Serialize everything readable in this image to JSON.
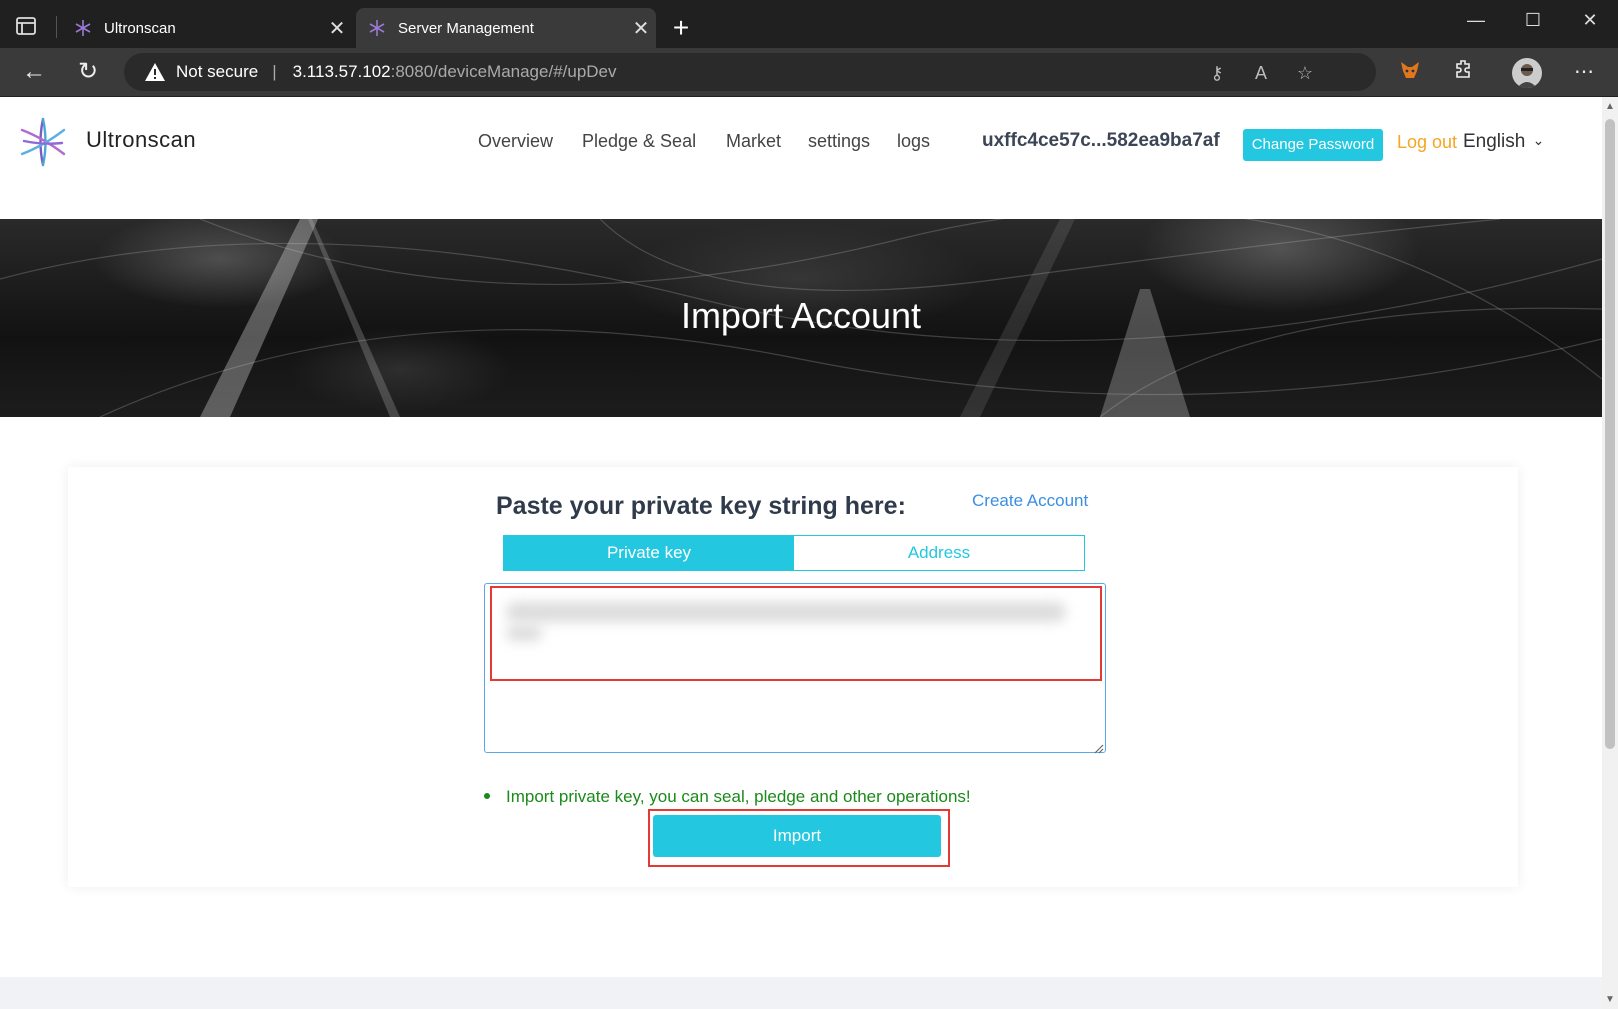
{
  "browser": {
    "tabs": [
      {
        "title": "Ultronscan",
        "active": false
      },
      {
        "title": "Server Management",
        "active": true
      }
    ],
    "address": {
      "security_label": "Not secure",
      "host": "3.113.57.102",
      "path": ":8080/deviceManage/#/upDev"
    }
  },
  "header": {
    "brand": "Ultronscan",
    "nav": [
      "Overview",
      "Pledge & Seal",
      "Market",
      "settings",
      "logs"
    ],
    "account": "uxffc4ce57c...582ea9ba7af",
    "change_password": "Change Password",
    "logout": "Log out",
    "language": "English"
  },
  "hero": {
    "title": "Import Account"
  },
  "form": {
    "title": "Paste your private key string here:",
    "create_link": "Create Account",
    "tabs": [
      "Private key",
      "Address"
    ],
    "active_tab": "Private key",
    "key_value": "",
    "hint": "Import private key, you can seal, pledge and other operations!",
    "import_button": "Import"
  },
  "colors": {
    "accent": "#23c8e0",
    "link": "#3b8ee0",
    "logout": "#f5a623",
    "hint": "#1a8a1a",
    "highlight": "#e53935"
  }
}
